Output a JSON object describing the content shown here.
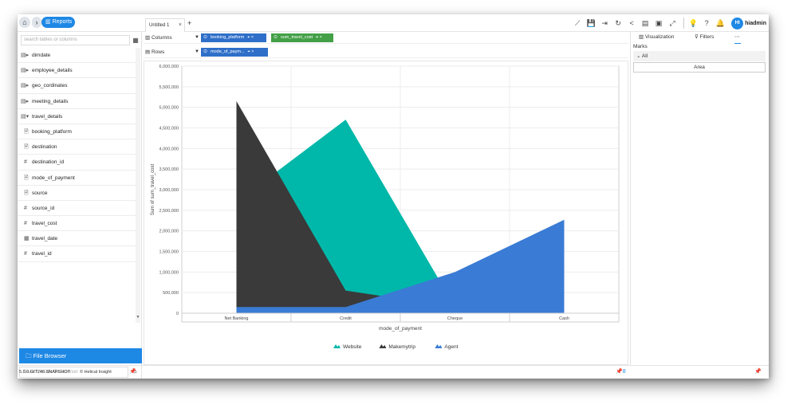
{
  "topbar": {
    "home_icon": "home-icon",
    "breadcrumb_arrow": "›",
    "reports_label": "Reports",
    "tab_label": "Untitled 1",
    "tab_close": "×",
    "tab_add": "+"
  },
  "toolbar": {
    "user_initials": "HI",
    "user_name": "hiadmin"
  },
  "left": {
    "search_placeholder": "search tables or columns",
    "tree": [
      {
        "label": "dimdate",
        "icon": "▤▸"
      },
      {
        "label": "employee_details",
        "icon": "▤▸"
      },
      {
        "label": "geo_cordinates",
        "icon": "▤▸"
      },
      {
        "label": "meeting_details",
        "icon": "▤▸"
      },
      {
        "label": "travel_details",
        "icon": "▤▾"
      },
      {
        "label": "booking_platform",
        "icon": "🗎"
      },
      {
        "label": "destination",
        "icon": "🗎"
      },
      {
        "label": "destination_id",
        "icon": "#"
      },
      {
        "label": "mode_of_payment",
        "icon": "🗎"
      },
      {
        "label": "source",
        "icon": "🗎"
      },
      {
        "label": "source_id",
        "icon": "#"
      },
      {
        "label": "travel_cost",
        "icon": "#"
      },
      {
        "label": "travel_date",
        "icon": "▦"
      },
      {
        "label": "travel_id",
        "icon": "#"
      }
    ],
    "file_browser_label": "File Browser",
    "file_search_placeholder": "Search inside file browser"
  },
  "status": {
    "version": "5.0.0.GIT246 SNAPSHOT",
    "brand": "Helical Insight",
    "page_count": "8"
  },
  "shelves": {
    "columns_label": "Columns",
    "rows_label": "Rows",
    "columns_pills": [
      "booking_platform",
      "sum_travel_cost"
    ],
    "rows_pills": [
      "mode_of_paym..."
    ]
  },
  "right": {
    "tab_visualization": "Visualization",
    "tab_filters": "Filters",
    "marks_label": "Marks",
    "all_label": "All",
    "area_label": "Area"
  },
  "colors": {
    "accent": "#1e88e5",
    "website": "#00b8a9",
    "makemytrip": "#3a3a3a",
    "agent": "#3a7bd5"
  },
  "chart_data": {
    "type": "area",
    "xlabel": "mode_of_payment",
    "ylabel": "Sum of sum_travel_cost",
    "categories": [
      "Net Banking",
      "Credit",
      "Cheque",
      "Cash"
    ],
    "ylim": [
      0,
      6000000
    ],
    "yticks": [
      0,
      500000,
      1000000,
      1500000,
      2000000,
      2500000,
      3000000,
      3500000,
      4000000,
      4500000,
      5000000,
      5500000,
      6000000
    ],
    "ytick_labels": [
      "0",
      "500,000",
      "1,000,000",
      "1,500,000",
      "2,000,000",
      "2,500,000",
      "3,000,000",
      "3,500,000",
      "4,000,000",
      "4,500,000",
      "5,000,000",
      "5,500,000",
      "6,000,000"
    ],
    "series": [
      {
        "name": "Website",
        "color": "#00b8a9",
        "values": [
          2700000,
          4700000,
          150000,
          0
        ]
      },
      {
        "name": "Makemytrip",
        "color": "#3a3a3a",
        "values": [
          5150000,
          550000,
          150000,
          0
        ]
      },
      {
        "name": "Agent",
        "color": "#3a7bd5",
        "values": [
          150000,
          150000,
          1000000,
          2270000
        ]
      }
    ],
    "legend_position": "bottom",
    "grid": true
  }
}
